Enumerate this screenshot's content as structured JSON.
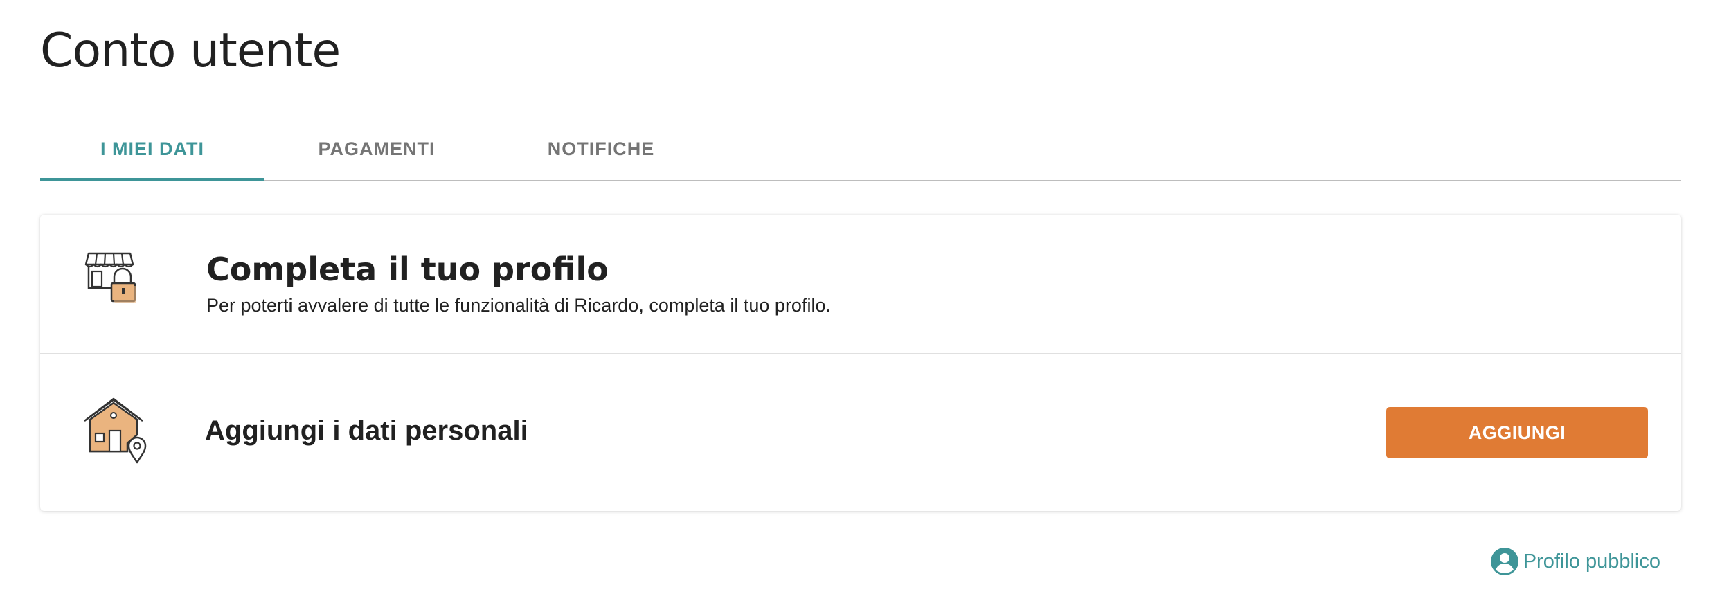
{
  "page": {
    "title": "Conto utente"
  },
  "tabs": [
    {
      "label": "I MIEI DATI",
      "active": true
    },
    {
      "label": "PAGAMENTI",
      "active": false
    },
    {
      "label": "NOTIFICHE",
      "active": false
    }
  ],
  "profile_card": {
    "title": "Completa il tuo profilo",
    "description": "Per poterti avvalere di tutte le funzionalità di Ricardo, completa il tuo profilo.",
    "icon": "shop-lock-icon",
    "items": [
      {
        "label": "Aggiungi i dati personali",
        "icon": "house-location-icon",
        "button_label": "AGGIUNGI"
      }
    ]
  },
  "public_profile": {
    "label": "Profilo pubblico",
    "icon": "user-circle-icon"
  },
  "colors": {
    "accent": "#3e9598",
    "button": "#e07b34",
    "icon_fill": "#eab47f"
  }
}
